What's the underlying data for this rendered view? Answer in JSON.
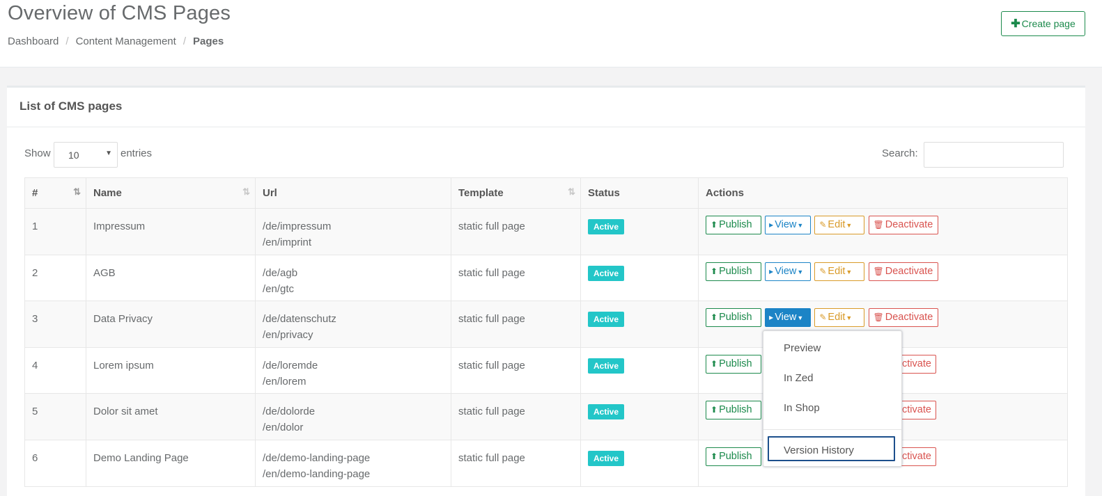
{
  "header": {
    "title": "Overview of CMS Pages",
    "breadcrumb": [
      "Dashboard",
      "Content Management",
      "Pages"
    ],
    "create_button": "Create page"
  },
  "panel": {
    "title": "List of CMS pages",
    "show_label": "Show",
    "entries_value": "10",
    "entries_label": "entries",
    "search_label": "Search:"
  },
  "table": {
    "columns": [
      "#",
      "Name",
      "Url",
      "Template",
      "Status",
      "Actions"
    ],
    "rows": [
      {
        "id": "1",
        "name": "Impressum",
        "url_de": "/de/impressum",
        "url_en": "/en/imprint",
        "template": "static full page",
        "status": "Active"
      },
      {
        "id": "2",
        "name": "AGB",
        "url_de": "/de/agb",
        "url_en": "/en/gtc",
        "template": "static full page",
        "status": "Active"
      },
      {
        "id": "3",
        "name": "Data Privacy",
        "url_de": "/de/datenschutz",
        "url_en": "/en/privacy",
        "template": "static full page",
        "status": "Active"
      },
      {
        "id": "4",
        "name": "Lorem ipsum",
        "url_de": "/de/loremde",
        "url_en": "/en/lorem",
        "template": "static full page",
        "status": "Active"
      },
      {
        "id": "5",
        "name": "Dolor sit amet",
        "url_de": "/de/dolorde",
        "url_en": "/en/dolor",
        "template": "static full page",
        "status": "Active"
      },
      {
        "id": "6",
        "name": "Demo Landing Page",
        "url_de": "/de/demo-landing-page",
        "url_en": "/en/demo-landing-page",
        "template": "static full page",
        "status": "Active"
      }
    ]
  },
  "actions": {
    "publish": "Publish",
    "view": "View",
    "edit": "Edit",
    "deactivate": "Deactivate",
    "partial_deactivate": "ctivate"
  },
  "view_dropdown": {
    "items": [
      "Preview",
      "In Zed",
      "In Shop"
    ],
    "history": "Version History"
  },
  "colors": {
    "publish": "#1c8a4c",
    "view": "#1c84c6",
    "edit": "#d99a28",
    "deactivate": "#d9534f",
    "status_active": "#23c6c8"
  }
}
